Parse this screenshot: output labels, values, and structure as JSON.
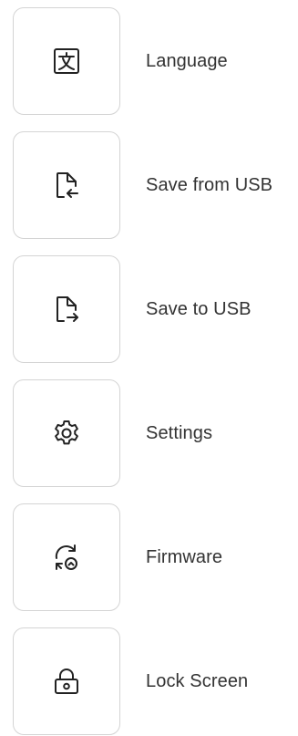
{
  "menu": {
    "items": [
      {
        "label": "Language",
        "icon": "language-icon"
      },
      {
        "label": "Save from USB",
        "icon": "file-import-icon"
      },
      {
        "label": "Save to USB",
        "icon": "file-export-icon"
      },
      {
        "label": "Settings",
        "icon": "gear-icon"
      },
      {
        "label": "Firmware",
        "icon": "firmware-update-icon"
      },
      {
        "label": "Lock Screen",
        "icon": "padlock-icon"
      }
    ]
  },
  "colors": {
    "tile_border": "#d4d4d4",
    "icon_stroke": "#222222",
    "label_text": "#333333"
  }
}
